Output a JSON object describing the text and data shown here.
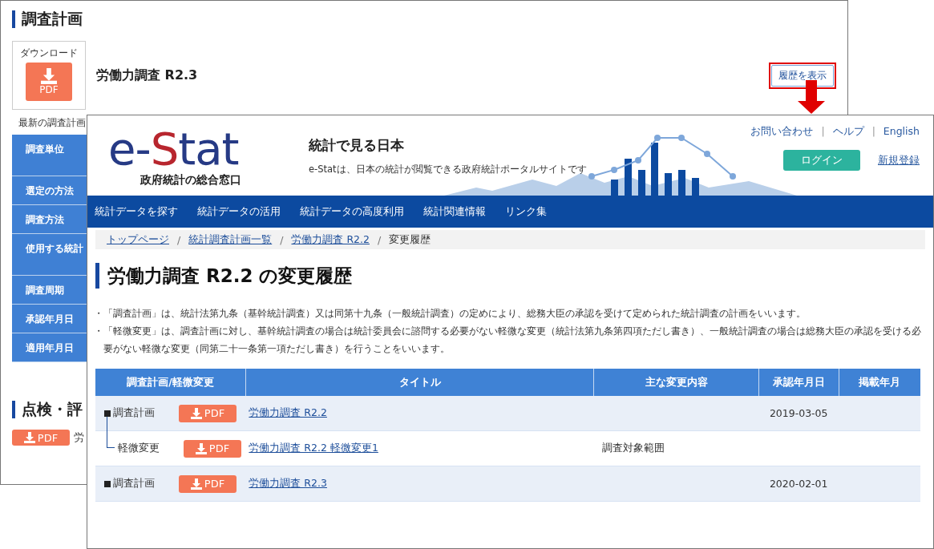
{
  "back_window": {
    "heading": "調査計画",
    "download": {
      "label": "ダウンロード",
      "button": "PDF"
    },
    "title": "労働力調査 R2.3",
    "history_button": {
      "label": "履歴を表示",
      "highlighted": true
    },
    "note": "最新の調査計画",
    "side_menu": [
      "調査単位",
      "選定の方法",
      "調査方法",
      "使用する統計",
      "調査周期",
      "承認年月日",
      "適用年月日"
    ],
    "section_heading": "点検・評",
    "pdf_button": "PDF",
    "link": "労"
  },
  "front_window": {
    "logo": {
      "parts": [
        {
          "text": "e-",
          "color": "#263a85"
        },
        {
          "text": "S",
          "color": "#b8262e"
        },
        {
          "text": "tat",
          "color": "#263a85"
        }
      ],
      "subtitle": "政府統計の総合窓口"
    },
    "tagline": "統計で見る日本",
    "description": "e-Statは、日本の統計が閲覧できる政府統計ポータルサイトです",
    "top_links": [
      "お問い合わせ",
      "ヘルプ",
      "English"
    ],
    "link_separators": [
      "|",
      "|"
    ],
    "breadcrumb_separators": [
      "/",
      "/",
      "/"
    ],
    "login_button": "ログイン",
    "register_link": "新規登録",
    "nav": [
      "統計データを探す",
      "統計データの活用",
      "統計データの高度利用",
      "統計関連情報",
      "リンク集"
    ],
    "breadcrumb": [
      {
        "label": "トップページ",
        "link": true
      },
      {
        "label": "統計調査計画一覧",
        "link": true
      },
      {
        "label": "労働力調査 R2.2",
        "link": true
      },
      {
        "label": "変更履歴",
        "link": false
      }
    ],
    "heading": "労働力調査 R2.2 の変更履歴",
    "notes": [
      {
        "bullet": "・",
        "text": "「調査計画」は、統計法第九条（基幹統計調査）又は同第十九条（一般統計調査）の定めにより、総務大臣の承認を受けて定められた統計調査の計画をいいます。"
      },
      {
        "bullet": "・",
        "text": "「軽微変更」は、調査計画に対し、基幹統計調査の場合は統計委員会に諮問する必要がない軽微な変更（統計法第九条第四項ただし書き）、一般統計調査の場合は総務大臣の承認を受ける必要がない軽微な変更（同第二十一条第一項ただし書き）を行うことをいいます。"
      }
    ],
    "table": {
      "columns": [
        "調査計画/軽微変更",
        "タイトル",
        "主な変更内容",
        "承認年月日",
        "掲載年月"
      ],
      "rows": [
        {
          "kind": "plan",
          "type_label": "調査計画",
          "pdf": "PDF",
          "title": "労働力調査 R2.2",
          "approved": "2019-03-05"
        },
        {
          "kind": "minor",
          "type_label": "軽微変更",
          "pdf": "PDF",
          "title": "労働力調査 R2.2 軽微変更1",
          "change": "調査対象範囲"
        },
        {
          "kind": "plan",
          "type_label": "調査計画",
          "pdf": "PDF",
          "title": "労働力調査 R2.3",
          "approved": "2020-02-01"
        }
      ]
    }
  }
}
